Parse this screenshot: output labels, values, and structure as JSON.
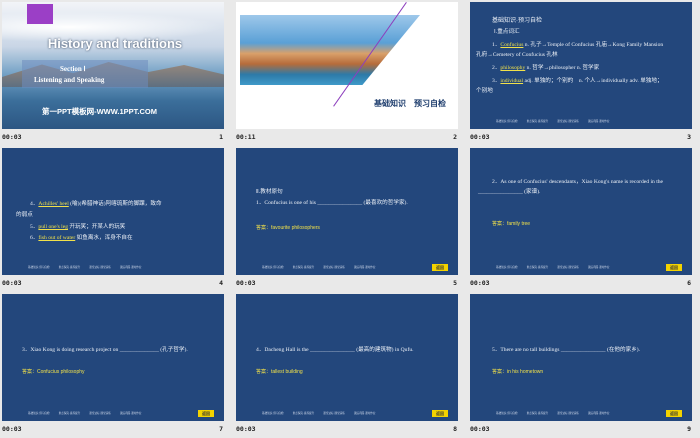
{
  "grid": {
    "slides": [
      {
        "time": "00:03",
        "num": "1"
      },
      {
        "time": "00:11",
        "num": "2"
      },
      {
        "time": "00:03",
        "num": "3"
      },
      {
        "time": "00:03",
        "num": "4"
      },
      {
        "time": "00:03",
        "num": "5"
      },
      {
        "time": "00:03",
        "num": "6"
      },
      {
        "time": "00:03",
        "num": "7"
      },
      {
        "time": "00:03",
        "num": "8"
      },
      {
        "time": "00:03",
        "num": "9"
      }
    ]
  },
  "slide1": {
    "title": "History and traditions",
    "section": "Section Ⅰ",
    "subtitle": "Listening and Speaking",
    "watermark": "第一PPT模板网-WWW.1PPT.COM"
  },
  "slide2": {
    "caption": "基础知识　预习自检"
  },
  "slide3": {
    "heading": "基础知识·预习自检",
    "sub": "Ⅰ.重点词汇",
    "l1a": "1．",
    "l1w": "Confucius",
    "l1b": " n. 孔子→Temple of Confucius 孔庙→Kong Family Mansion",
    "l1c": "孔府→Cemetery of Confucius 孔林",
    "l2a": "2．",
    "l2w": "philosophy",
    "l2b": " n. 哲学→philosopher n. 哲学家",
    "l3a": "3．",
    "l3w": "individual",
    "l3b": " adj. 单独的；个别的　n. 个人→individually adv. 单独地；",
    "l3c": "个别地"
  },
  "slide4": {
    "l1a": "4．",
    "l1w": "Achilles' heel",
    "l1b": " (喻)(希腊神话)阿喀琉斯的脚踝，致命",
    "l1c": "的弱点",
    "l2a": "5．",
    "l2w": "pull one's leg",
    "l2b": " 开玩笑；开某人的玩笑",
    "l3a": "6．",
    "l3w": "fish out of water",
    "l3b": " 如鱼离水，浑身不自在"
  },
  "slide5": {
    "sub": "Ⅱ.教材原句",
    "q": "1．Confucius is one of his ________________ (最喜欢的哲学家).",
    "ans": "答案：favourite philosophers"
  },
  "slide6": {
    "q1": "2．As one of Confucius' descendants，Xiao Kong's name is recorded in the",
    "q2": "________________ (家谱).",
    "ans": "答案：family tree"
  },
  "slide7": {
    "q": "3．Xiao Kong is doing research project on ______________ (孔子哲学).",
    "ans": "答案：Confucius philosophy"
  },
  "slide8": {
    "q": "4．Dacheng Hall is the ________________ (最高的建筑物) in Qufu.",
    "ans": "答案：tallest building"
  },
  "slide9": {
    "q": "5．There are no tall buildings ________________ (在他的家乡).",
    "ans": "答案：in his hometown"
  },
  "nav": [
    "基础知识·预习自检",
    "重点探究·素养提升",
    "课堂达标·随堂演练",
    "课后巩固·课时作业"
  ],
  "badge": "返回"
}
